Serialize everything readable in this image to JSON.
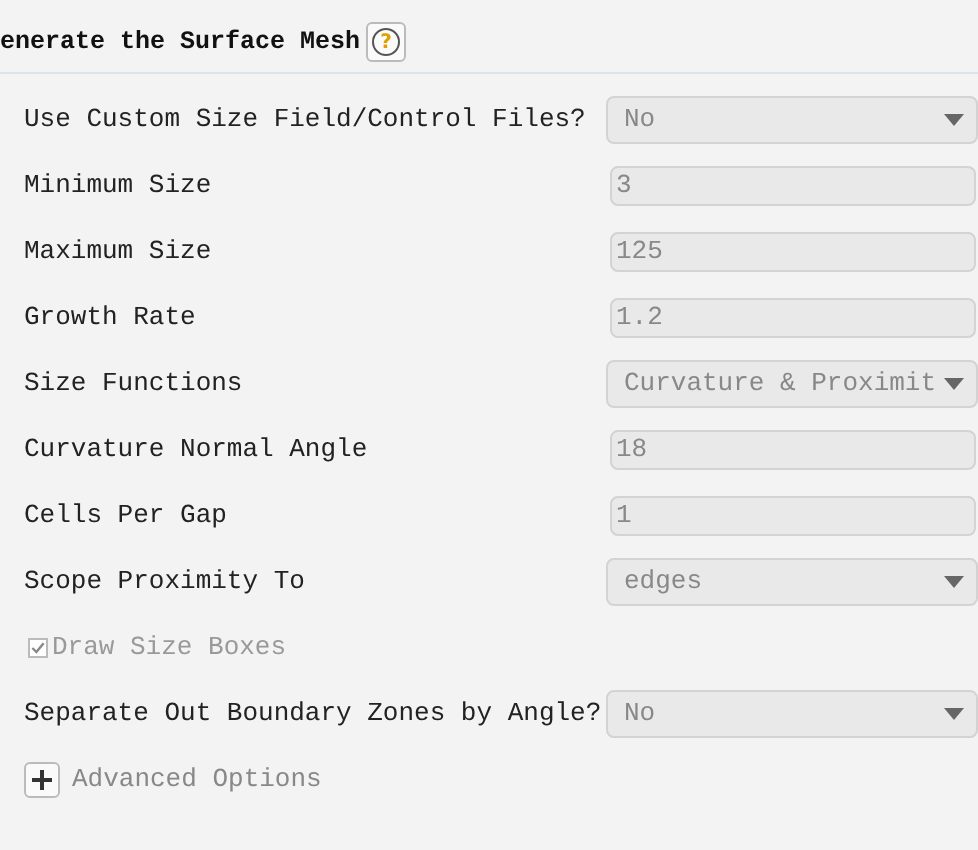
{
  "header": {
    "title": "enerate the Surface Mesh",
    "help_icon": "?"
  },
  "rows": [
    {
      "kind": "dropdown",
      "label": "Use Custom Size Field/Control Files?",
      "value": "No"
    },
    {
      "kind": "text",
      "label": "Minimum Size",
      "value": "3"
    },
    {
      "kind": "text",
      "label": "Maximum Size",
      "value": "125"
    },
    {
      "kind": "text",
      "label": "Growth Rate",
      "value": "1.2"
    },
    {
      "kind": "dropdown",
      "label": "Size Functions",
      "value": "Curvature & Proximit"
    },
    {
      "kind": "text",
      "label": "Curvature Normal Angle",
      "value": "18"
    },
    {
      "kind": "text",
      "label": "Cells Per Gap",
      "value": "1"
    },
    {
      "kind": "dropdown",
      "label": "Scope Proximity To",
      "value": "edges"
    },
    {
      "kind": "checkbox",
      "label": "Draw Size Boxes",
      "checked": true,
      "disabled": true
    },
    {
      "kind": "dropdown",
      "label": "Separate Out Boundary Zones by Angle?",
      "value": "No"
    },
    {
      "kind": "expander",
      "label": "Advanced Options",
      "expanded": false
    }
  ]
}
